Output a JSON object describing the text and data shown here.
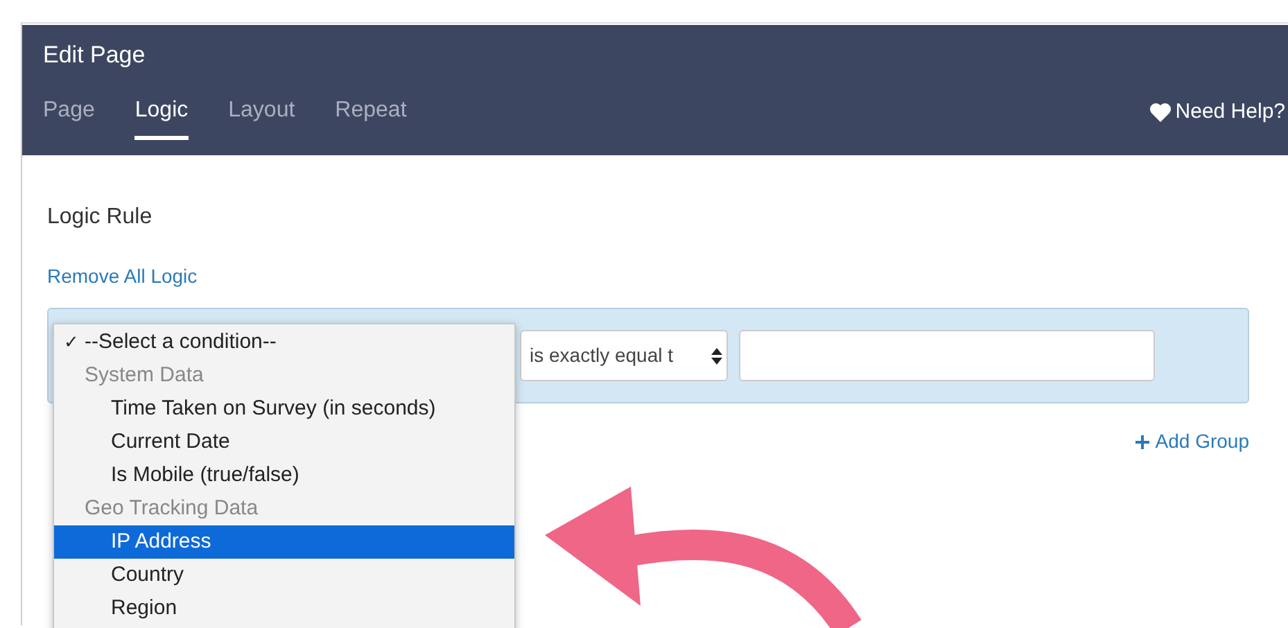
{
  "window": {
    "title": "Edit Page"
  },
  "tabs": [
    {
      "label": "Page",
      "selected": false
    },
    {
      "label": "Logic",
      "selected": true
    },
    {
      "label": "Layout",
      "selected": false
    },
    {
      "label": "Repeat",
      "selected": false
    }
  ],
  "help_link": "Need Help?",
  "section_title": "Logic Rule",
  "remove_link": "Remove All Logic",
  "rule": {
    "operator": "is exactly equal t"
  },
  "add_group": "Add Group",
  "condition_menu": [
    {
      "kind": "option",
      "check_mark": "✓",
      "label": "--Select a condition--",
      "checked": true,
      "selected": false
    },
    {
      "kind": "group",
      "label": "System Data"
    },
    {
      "kind": "item",
      "label": "Time Taken on Survey (in seconds)",
      "selected": false
    },
    {
      "kind": "item",
      "label": "Current Date",
      "selected": false
    },
    {
      "kind": "item",
      "label": "Is Mobile (true/false)",
      "selected": false
    },
    {
      "kind": "group",
      "label": "Geo Tracking Data"
    },
    {
      "kind": "item",
      "label": "IP Address",
      "selected": true
    },
    {
      "kind": "item",
      "label": "Country",
      "selected": false
    },
    {
      "kind": "item",
      "label": "Region",
      "selected": false
    }
  ]
}
